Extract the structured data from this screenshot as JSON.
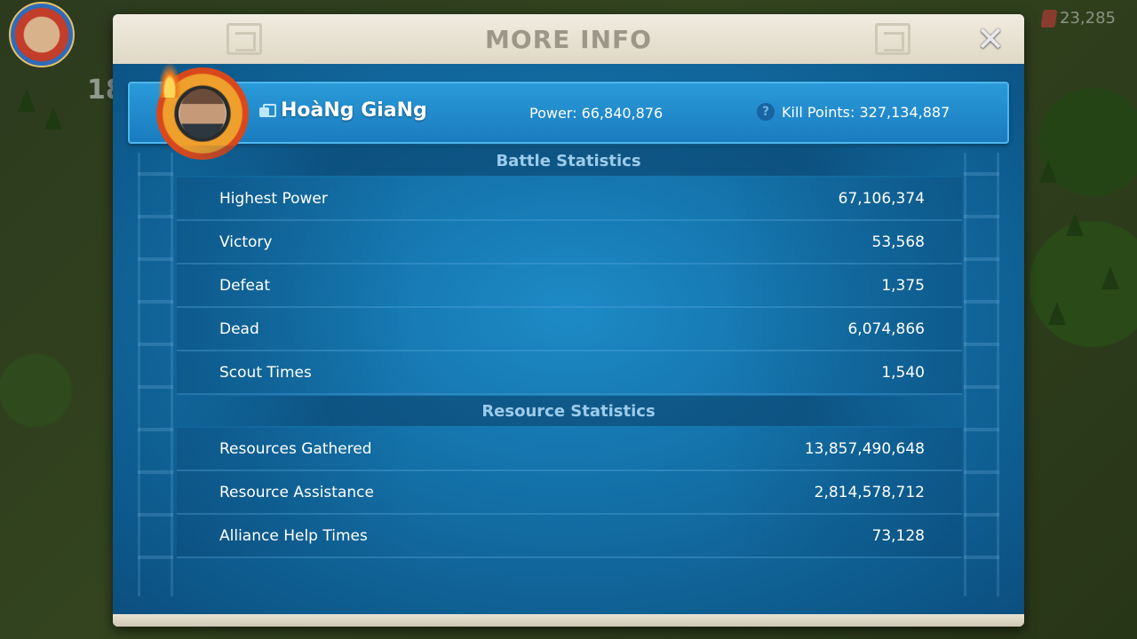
{
  "hud": {
    "level": "18",
    "gems": "23,285"
  },
  "modal": {
    "title": "MORE INFO"
  },
  "player": {
    "name": "HoàNg GiaNg",
    "power": "Power: 66,840,876",
    "kill_points": "Kill Points: 327,134,887"
  },
  "battle_statistics": {
    "header": "Battle Statistics",
    "rows": [
      {
        "label": "Highest Power",
        "value": "67,106,374"
      },
      {
        "label": "Victory",
        "value": "53,568"
      },
      {
        "label": "Defeat",
        "value": "1,375"
      },
      {
        "label": "Dead",
        "value": "6,074,866"
      },
      {
        "label": "Scout Times",
        "value": "1,540"
      }
    ]
  },
  "resource_statistics": {
    "header": "Resource Statistics",
    "rows": [
      {
        "label": "Resources Gathered",
        "value": "13,857,490,648"
      },
      {
        "label": "Resource Assistance",
        "value": "2,814,578,712"
      },
      {
        "label": "Alliance Help Times",
        "value": "73,128"
      }
    ]
  },
  "icons": {
    "close": "close-icon",
    "copy": "copy-icon",
    "help": "help-icon",
    "gem": "gem-icon"
  },
  "colors": {
    "panel_blue": "#1a7cbf",
    "header_text": "#9c9788",
    "section_text": "#9ccbea"
  }
}
